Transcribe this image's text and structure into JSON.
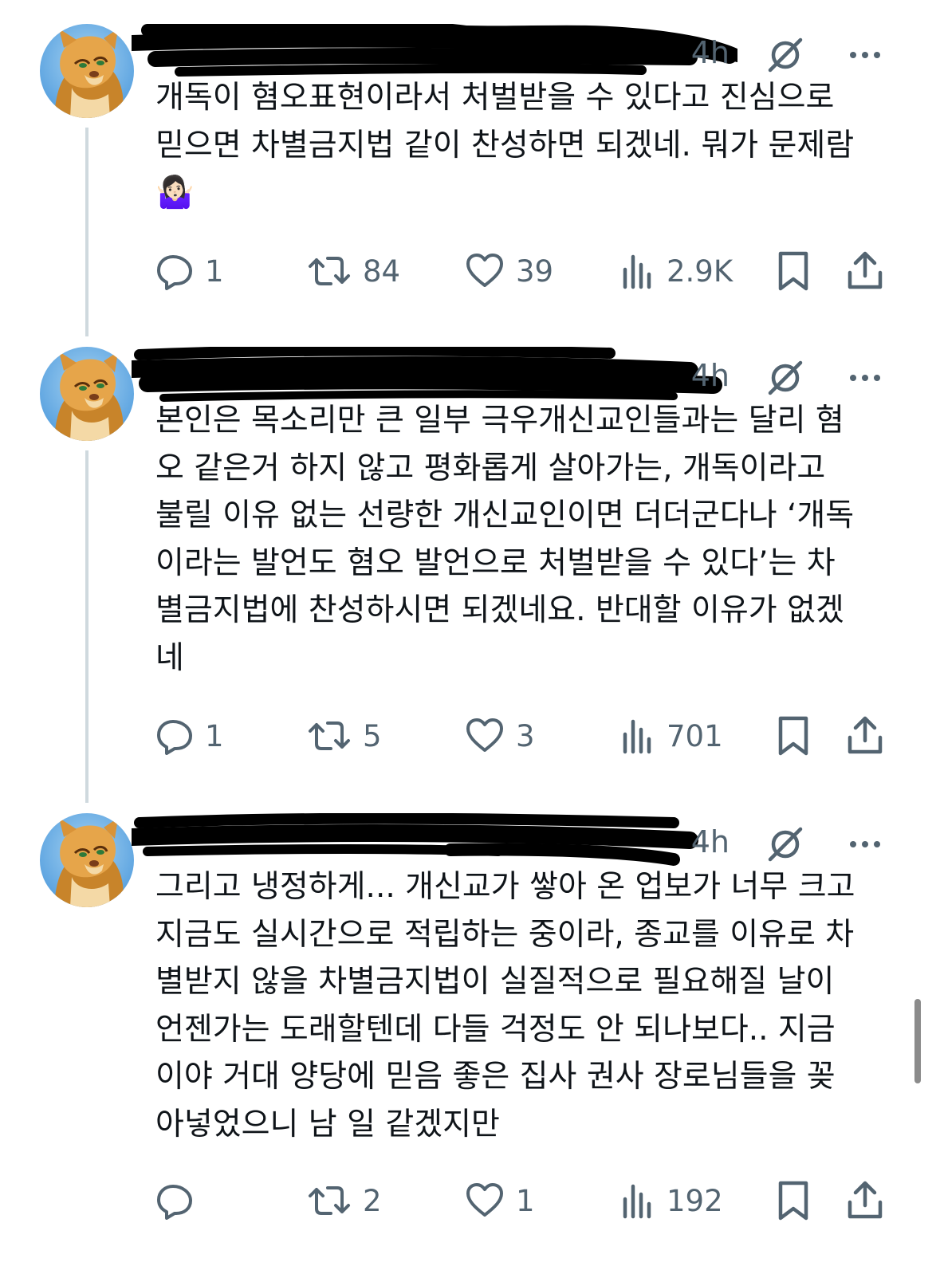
{
  "posts": [
    {
      "time": "4h",
      "text": "개독이 혐오표현이라서 처벌받을 수 있다고 진심으로\n믿으면 차별금지법 같이 찬성하면 되겠네. 뭐가 문제람\n🤷🏻‍♀️",
      "reply_count": "1",
      "repost_count": "84",
      "like_count": "39",
      "view_count": "2.9K"
    },
    {
      "time": "4h",
      "text": "본인은 목소리만 큰 일부 극우개신교인들과는 달리 혐\n오 같은거 하지 않고 평화롭게 살아가는, 개독이라고\n불릴 이유 없는 선량한 개신교인이면 더더군다나 ‘개독\n이라는 발언도 혐오 발언으로 처벌받을 수 있다’는 차\n별금지법에 찬성하시면 되겠네요. 반대할 이유가 없겠\n네",
      "reply_count": "1",
      "repost_count": "5",
      "like_count": "3",
      "view_count": "701"
    },
    {
      "time": "4h",
      "text": "그리고 냉정하게... 개신교가 쌓아 온 업보가 너무 크고\n지금도 실시간으로 적립하는 중이라, 종교를 이유로 차\n별받지 않을 차별금지법이 실질적으로 필요해질 날이\n언젠가는 도래할텐데 다들 걱정도 안 되나보다.. 지금\n이야 거대 양당에 믿음 좋은 집사 권사 장로님들을 꽂\n아넣었으니 남 일 같겠지만",
      "reply_count": "",
      "repost_count": "2",
      "like_count": "1",
      "view_count": "192"
    }
  ],
  "icons": {
    "reply": "reply-icon",
    "repost": "repost-icon",
    "like": "heart-icon",
    "views": "views-icon",
    "bookmark": "bookmark-icon",
    "share": "share-icon",
    "grok": "grok-icon",
    "more": "more-icon"
  },
  "colors": {
    "text": "#0f1419",
    "secondary": "#536471",
    "thread_line": "#cfd9de",
    "redaction": "#000000"
  }
}
